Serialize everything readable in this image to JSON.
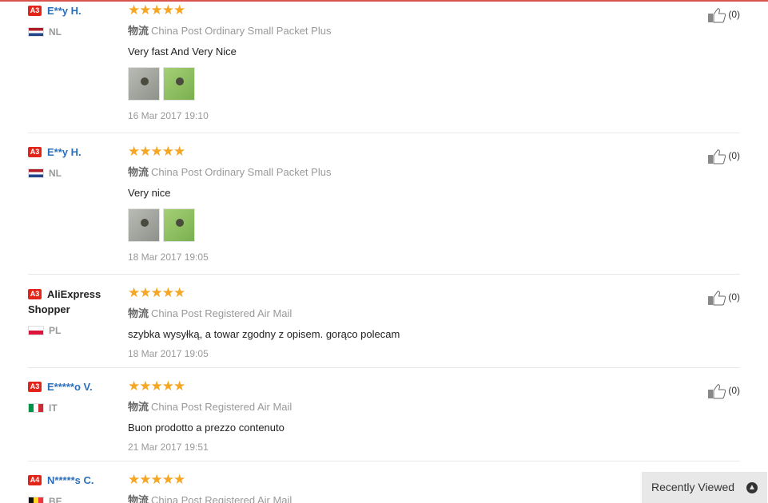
{
  "reviews": [
    {
      "level": "A3",
      "name": "E**y H.",
      "country": "NL",
      "flag": "nl",
      "shipping_cn": "物流",
      "shipping": "China Post Ordinary Small Packet Plus",
      "text": "Very fast And Very Nice",
      "date": "16 Mar 2017 19:10",
      "useful": "(0)",
      "rating": 5
    },
    {
      "level": "A3",
      "name": "E**y H.",
      "country": "NL",
      "flag": "nl",
      "shipping_cn": "物流",
      "shipping": "China Post Ordinary Small Packet Plus",
      "text": "Very nice",
      "date": "18 Mar 2017 19:05",
      "useful": "(0)",
      "rating": 5
    },
    {
      "level": "A3",
      "name": "AliExpress Shopper",
      "country": "PL",
      "flag": "pl",
      "shipping_cn": "物流",
      "shipping": "China Post Registered Air Mail",
      "text": "szybka wysyłką, a towar zgodny z opisem. gorąco polecam",
      "date": "18 Mar 2017 19:05",
      "useful": "(0)",
      "rating": 5
    },
    {
      "level": "A3",
      "name": "E*****o V.",
      "country": "IT",
      "flag": "it",
      "shipping_cn": "物流",
      "shipping": "China Post Registered Air Mail",
      "text": "Buon prodotto a prezzo contenuto",
      "date": "21 Mar 2017 19:51",
      "useful": "(0)",
      "rating": 5
    },
    {
      "level": "A4",
      "name": "N*****s C.",
      "country": "BE",
      "flag": "be",
      "shipping_cn": "物流",
      "shipping": "China Post Registered Air Mail",
      "rating": 5
    }
  ],
  "recently_viewed": {
    "label": "Recently Viewed",
    "icon": "chevron-up-icon"
  }
}
